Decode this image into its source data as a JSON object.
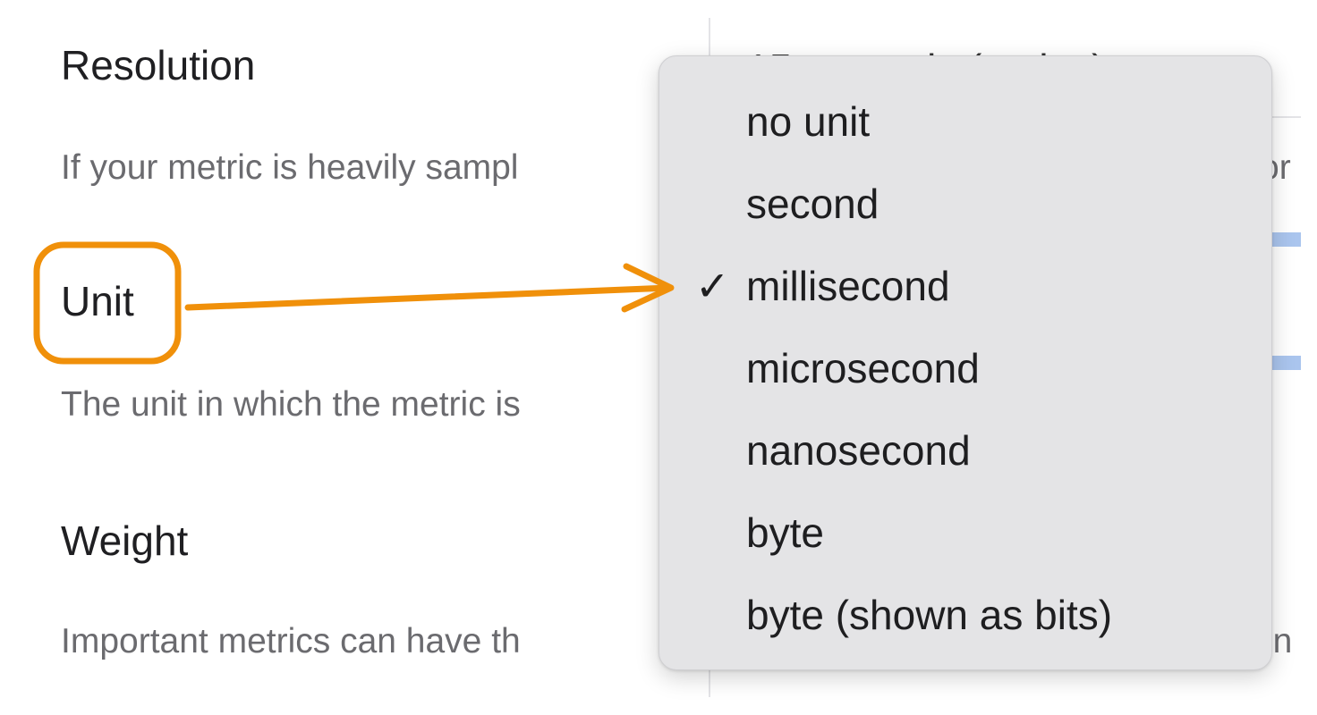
{
  "settings": {
    "resolution": {
      "label": "Resolution",
      "description": "If your metric is heavily sampl"
    },
    "unit": {
      "label": "Unit",
      "description": "The unit in which the metric is"
    },
    "weight": {
      "label": "Weight",
      "description": "Important metrics can have th"
    }
  },
  "resolution_select": {
    "value": "15 seconds (native)"
  },
  "right_panel_fragments": {
    "resolution_desc_tail": "or",
    "weight_desc_tail": "in"
  },
  "unit_menu": {
    "selected": "millisecond",
    "check_glyph": "✓",
    "items": [
      {
        "label": "no unit"
      },
      {
        "label": "second"
      },
      {
        "label": "millisecond"
      },
      {
        "label": "microsecond"
      },
      {
        "label": "nanosecond"
      },
      {
        "label": "byte"
      },
      {
        "label": "byte (shown as bits)"
      }
    ]
  },
  "annotation": {
    "color": "#F0900A",
    "shape": "rounded-box-with-arrow"
  }
}
